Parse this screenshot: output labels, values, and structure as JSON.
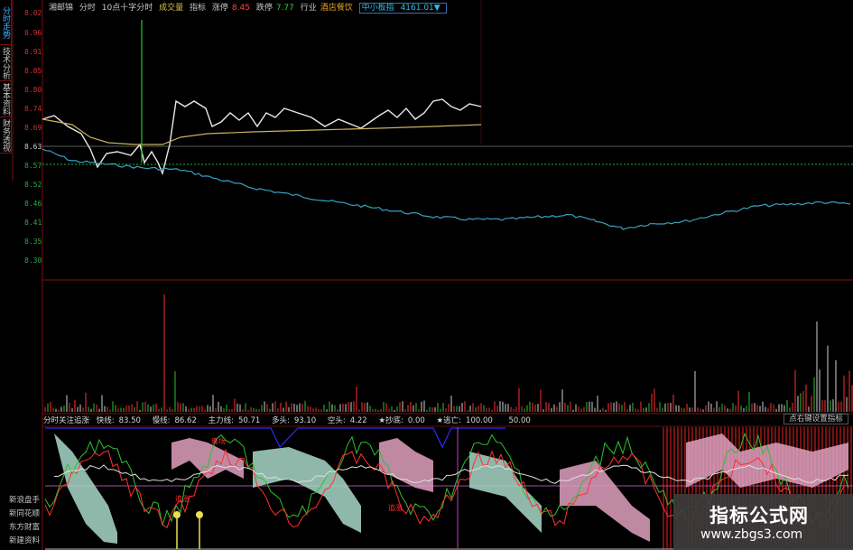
{
  "left_tabs": [
    {
      "label": "分时走势",
      "active": true
    },
    {
      "label": "技术分析",
      "active": false
    },
    {
      "label": "基本资料",
      "active": false
    },
    {
      "label": "财务透视",
      "active": false
    }
  ],
  "header": {
    "name": "湘邮锦",
    "period": "分时",
    "formula": "10点十字分时",
    "volume": "成交量",
    "index": "指标",
    "rise_label": "涨停",
    "rise_value": "8.45",
    "fall_label": "跌停",
    "fall_value": "7.77",
    "industry_label": "行业",
    "industry": "酒店餐饮",
    "board": "中小板指",
    "board_value": "4161.01▼"
  },
  "price_labels": [
    "8.02",
    "8.96",
    "8.91",
    "8.85",
    "8.80",
    "8.74",
    "8.69",
    "8.63",
    "8.57",
    "8.52",
    "8.46",
    "8.41",
    "8.35",
    "8.30"
  ],
  "indicator": {
    "title": "分时关注追涨",
    "items": [
      {
        "label": "快线:",
        "value": "83.50"
      },
      {
        "label": "慢线:",
        "value": "86.62"
      },
      {
        "label": "主力线:",
        "value": "50.71"
      },
      {
        "label": "多头:",
        "value": "93.10"
      },
      {
        "label": "空头:",
        "value": "4.22"
      },
      {
        "label": "★抄底:",
        "value": "0.00"
      },
      {
        "label": "★逃亡:",
        "value": "100.00"
      },
      {
        "label": "",
        "value": "50.00"
      }
    ],
    "setting_button": "点右键设置指标",
    "annotations": [
      "离场",
      "追涨",
      "追涨"
    ]
  },
  "bottom_tabs": [
    "新浪盘手",
    "新同花顺",
    "东方财富",
    "新建资料"
  ],
  "watermark": {
    "title": "指标公式网",
    "url": "www.zbgs3.com"
  },
  "colors": {
    "price_line": "#e8e8e8",
    "avg_line": "#c8b060",
    "index_line": "#3aa0c0",
    "up": "#ff3030",
    "down": "#30c030"
  }
}
